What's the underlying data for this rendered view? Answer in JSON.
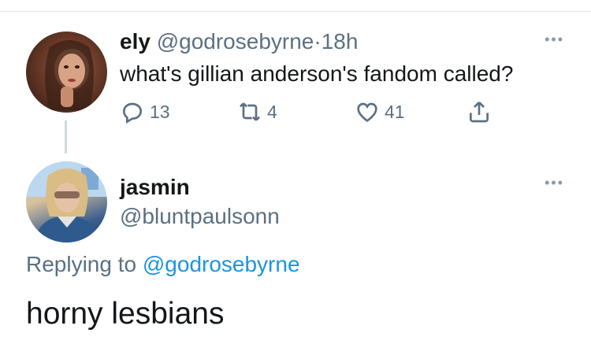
{
  "tweet": {
    "name": "ely",
    "handle": "@godrosebyrne",
    "separator": "·",
    "time": "18h",
    "text": "what's gillian anderson's fandom called?",
    "actions": {
      "reply_count": "13",
      "retweet_count": "4",
      "like_count": "41"
    },
    "more": "•••"
  },
  "reply": {
    "name": "jasmin",
    "handle": "@bluntpaulsonn",
    "replying_prefix": "Replying to",
    "replying_to": "@godrosebyrne",
    "text": "horny lesbians",
    "more": "•••"
  },
  "colors": {
    "text_primary": "#14171a",
    "text_secondary": "#5b7083",
    "link": "#1b95e0",
    "divider": "#dfe3e6"
  },
  "icons": [
    "reply-icon",
    "retweet-icon",
    "like-icon",
    "share-icon",
    "more-icon"
  ]
}
